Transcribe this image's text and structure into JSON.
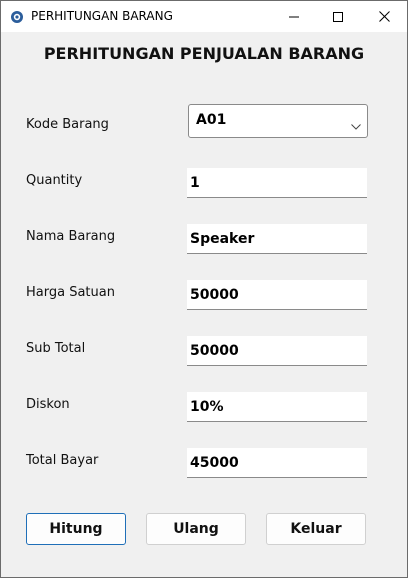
{
  "window": {
    "title": "PERHITUNGAN BARANG"
  },
  "form": {
    "heading": "PERHITUNGAN PENJUALAN BARANG",
    "kode_barang": {
      "label": "Kode Barang",
      "value": "A01"
    },
    "quantity": {
      "label": "Quantity",
      "value": "1"
    },
    "nama_barang": {
      "label": "Nama Barang",
      "value": "Speaker"
    },
    "harga_satuan": {
      "label": "Harga Satuan",
      "value": "50000"
    },
    "sub_total": {
      "label": "Sub Total",
      "value": "50000"
    },
    "diskon": {
      "label": "Diskon",
      "value": "10%"
    },
    "total_bayar": {
      "label": "Total Bayar",
      "value": "45000"
    }
  },
  "buttons": {
    "hitung": "Hitung",
    "ulang": "Ulang",
    "keluar": "Keluar"
  },
  "icons": {
    "app": "app-icon",
    "minimize": "minimize-icon",
    "maximize": "maximize-icon",
    "close": "close-icon",
    "dropdown": "chevron-down-icon"
  },
  "colors": {
    "accent": "#1f6fb8"
  }
}
